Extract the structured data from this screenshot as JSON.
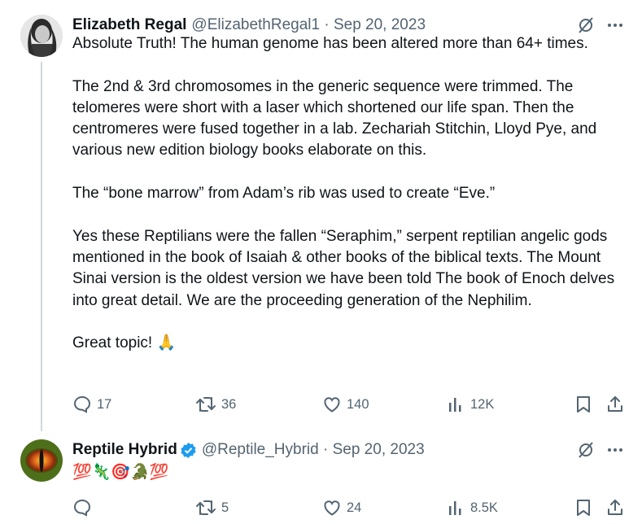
{
  "tweets": [
    {
      "author_name": "Elizabeth Regal",
      "handle_date": "@ElizabethRegal1 · Sep 20, 2023",
      "text": "Absolute Truth! The human genome has been altered more than 64+ times.\n\nThe 2nd & 3rd chromosomes in the generic sequence were trimmed. The telomeres were short with a laser which shortened our life span. Then the centromeres were fused together in a lab. Zechariah Stitchin, Lloyd Pye, and various new edition biology books elaborate on this.\n\nThe “bone marrow” from Adam’s rib was used to create “Eve.”\n\nYes these Reptilians were the fallen “Seraphim,” serpent reptilian angelic gods mentioned in the book of Isaiah & other books of the biblical texts. The Mount Sinai version is the oldest version we have been told The book of Enoch delves into great detail. We are the proceeding generation of the Nephilim.\n\nGreat topic! 🙏",
      "replies": "17",
      "reposts": "36",
      "likes": "140",
      "views": "12K"
    },
    {
      "author_name": "Reptile Hybrid",
      "handle_date": "@Reptile_Hybrid · Sep 20, 2023",
      "text": "💯🦎🎯🐊💯",
      "replies": "",
      "reposts": "5",
      "likes": "24",
      "views": "8.5K"
    }
  ],
  "icons": {
    "grok": "grok-icon",
    "more": "more-icon",
    "reply": "reply-icon",
    "repost": "repost-icon",
    "like": "heart-icon",
    "views": "views-icon",
    "bookmark": "bookmark-icon",
    "share": "share-icon",
    "verified": "verified-badge-icon"
  },
  "colors": {
    "text": "#0f1419",
    "secondary": "#536471",
    "verified": "#1d9bf0",
    "thread_line": "#cfd9de"
  }
}
